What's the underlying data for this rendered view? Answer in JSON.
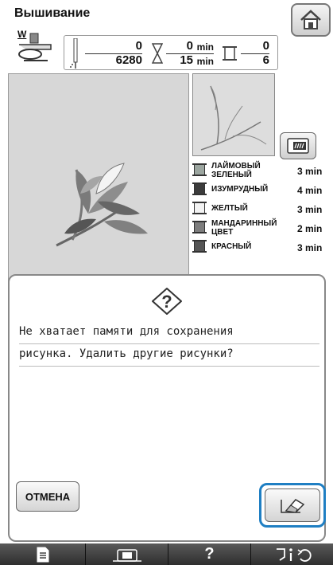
{
  "header": {
    "title": "Вышивание",
    "presser_letter": "W"
  },
  "stats": {
    "stitch_current": "0",
    "stitch_total": "6280",
    "time_current": "0",
    "time_total": "15",
    "time_unit": "min",
    "color_current": "0",
    "color_total": "6"
  },
  "thread_colors": [
    {
      "name": "ЛАЙМОВЫЙ ЗЕЛЕНЫЙ",
      "time": "3 min",
      "swatch": "#9ca6a0"
    },
    {
      "name": "ИЗУМРУДНЫЙ",
      "time": "4 min",
      "swatch": "#3c3c3c"
    },
    {
      "name": "ЖЕЛТЫЙ",
      "time": "3 min",
      "swatch": "#f2f2f2"
    },
    {
      "name": "МАНДАРИННЫЙ ЦВЕТ",
      "time": "2 min",
      "swatch": "#7d7d7d"
    },
    {
      "name": "КРАСНЫЙ",
      "time": "3 min",
      "swatch": "#555555"
    }
  ],
  "dialog": {
    "icon": "question-icon",
    "message_line1": "Не хватает памяти для сохранения",
    "message_line2": "рисунка. Удалить другие рисунки?",
    "cancel_label": "ОТМЕНА",
    "ok_icon": "eraser-icon"
  },
  "bottom_bar": {
    "tab_help_label": "?",
    "icons": [
      "page-icon",
      "embroidery-frame-icon",
      "help-icon",
      "needle-info-icon"
    ]
  },
  "colors": {
    "highlight": "#1f7fc3",
    "bottom_bar": "#3a3a3a",
    "panel_gray": "#d7d7d7"
  }
}
